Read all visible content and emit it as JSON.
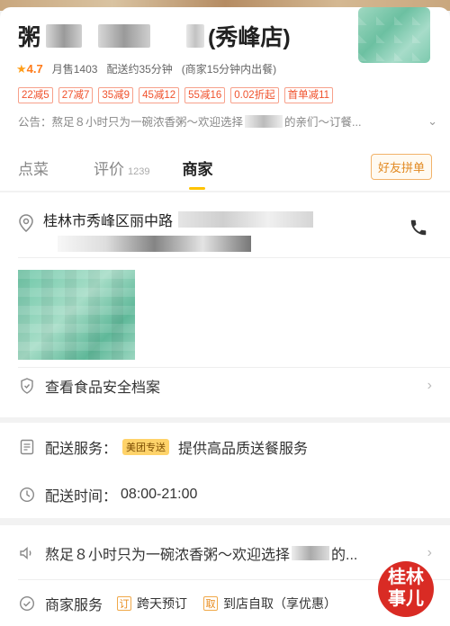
{
  "store": {
    "name_prefix": "粥",
    "name_suffix": "(秀峰店)",
    "rating": "4.7",
    "monthly_sales": "月售1403",
    "delivery_time": "配送约35分钟",
    "prep_time": "(商家15分钟内出餐)"
  },
  "coupons": [
    "22减5",
    "27减7",
    "35减9",
    "45减12",
    "55减16",
    "0.02折起",
    "首单减11"
  ],
  "notice": {
    "part1": "公告：熬足８小时只为一碗浓香粥～欢迎选择",
    "part2": "的亲们～订餐..."
  },
  "tabs": [
    {
      "label": "点菜"
    },
    {
      "label": "评价",
      "count": "1239"
    },
    {
      "label": "商家"
    }
  ],
  "group_button": "好友拼单",
  "address": {
    "text": "桂林市秀峰区丽中路"
  },
  "rows": {
    "food_safety": "查看食品安全档案",
    "delivery_service_label": "配送服务：",
    "delivery_badge": "美团专送",
    "delivery_service_desc": "提供高品质送餐服务",
    "delivery_hours_label": "配送时间：",
    "delivery_hours": "08:00-21:00",
    "announcement_part1": "熬足８小时只为一碗浓香粥～欢迎选择",
    "announcement_part2": "的...",
    "merchant_service_label": "商家服务",
    "svc1_tag": "订",
    "svc1": "跨天预订",
    "svc2_tag": "取",
    "svc2": "到店自取（享优惠）"
  },
  "watermark": {
    "line1": "桂林",
    "line2": "事儿"
  },
  "colors": {
    "accent": "#ffc300",
    "coupon_red": "#f0522d",
    "orange": "#ff7b1a"
  }
}
